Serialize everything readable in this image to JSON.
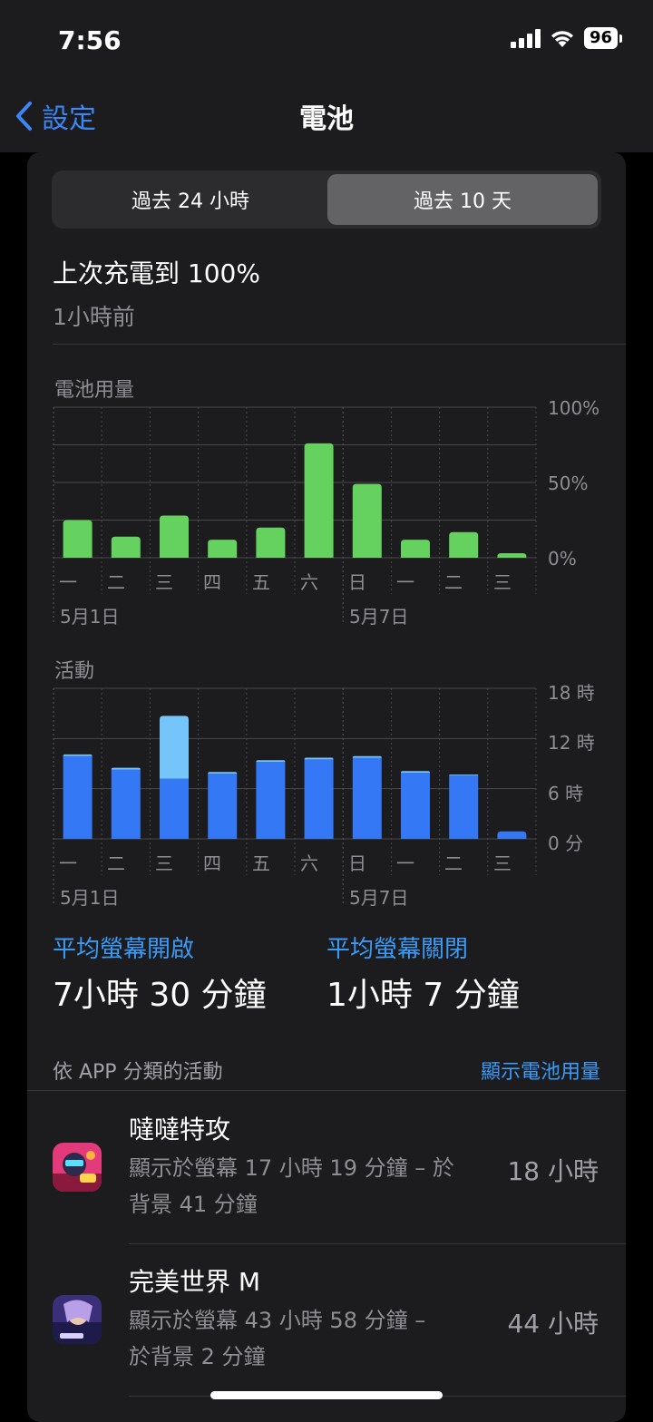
{
  "status_bar": {
    "time": "7:56",
    "battery_level": "96"
  },
  "nav": {
    "back_label": "設定",
    "title": "電池"
  },
  "segments": {
    "left": "過去 24 小時",
    "right": "過去 10 天",
    "selected": "right"
  },
  "last_charge": {
    "title": "上次充電到 100%",
    "time_ago": "1小時前"
  },
  "battery_chart": {
    "label": "電池用量",
    "y_ticks": [
      "100%",
      "50%",
      "0%"
    ],
    "days": [
      "一",
      "二",
      "三",
      "四",
      "五",
      "六",
      "日",
      "一",
      "二",
      "三"
    ],
    "date_labels": [
      "5月1日",
      "5月7日"
    ]
  },
  "activity_chart": {
    "label": "活動",
    "y_ticks": [
      "18 時",
      "12 時",
      "6 時",
      "0 分"
    ],
    "days": [
      "一",
      "二",
      "三",
      "四",
      "五",
      "六",
      "日",
      "一",
      "二",
      "三"
    ],
    "date_labels": [
      "5月1日",
      "5月7日"
    ]
  },
  "chart_data": [
    {
      "type": "bar",
      "title": "電池用量",
      "categories": [
        "一",
        "二",
        "三",
        "四",
        "五",
        "六",
        "日",
        "一",
        "二",
        "三"
      ],
      "values": [
        25,
        14,
        28,
        12,
        20,
        76,
        49,
        12,
        17,
        3
      ],
      "ylim": [
        0,
        100
      ],
      "ylabel_ticks": [
        "0%",
        "50%",
        "100%"
      ],
      "color": "#65d15f",
      "grid": true
    },
    {
      "type": "bar",
      "title": "活動",
      "stacked": true,
      "categories": [
        "一",
        "二",
        "三",
        "四",
        "五",
        "六",
        "日",
        "一",
        "二",
        "三"
      ],
      "series": [
        {
          "values": [
            9.9,
            8.3,
            7.2,
            7.8,
            9.2,
            9.5,
            9.7,
            7.9,
            7.6,
            0.9
          ],
          "color": "#3478f6"
        },
        {
          "values": [
            0.2,
            0.2,
            7.5,
            0.2,
            0.2,
            0.2,
            0.2,
            0.2,
            0.1,
            0.0
          ],
          "color": "#76c5fa"
        }
      ],
      "ylim": [
        0,
        18
      ],
      "ylabel_ticks": [
        "0 分",
        "6 時",
        "12 時",
        "18 時"
      ],
      "grid": true
    }
  ],
  "metrics": {
    "screen_on_label": "平均螢幕開啟",
    "screen_on_value": "7小時 30 分鐘",
    "screen_off_label": "平均螢幕關閉",
    "screen_off_value": "1小時 7 分鐘"
  },
  "apps_section": {
    "header": "依 APP 分類的活動",
    "link": "顯示電池用量"
  },
  "apps": [
    {
      "name": "噠噠特攻",
      "detail_line1": "顯示於螢幕 17 小時 19 分鐘 – 於",
      "detail_line2": "背景 41 分鐘",
      "total": "18 小時"
    },
    {
      "name": "完美世界 M",
      "detail_line1": "顯示於螢幕 43 小時 58 分鐘 –",
      "detail_line2": "於背景 2 分鐘",
      "total": "44 小時"
    }
  ]
}
